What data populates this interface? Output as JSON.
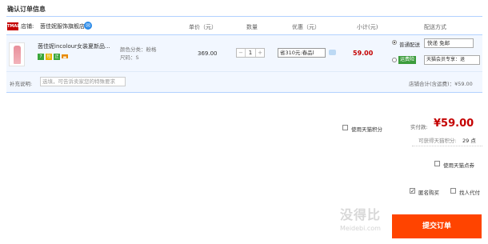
{
  "page": {
    "title": "确认订单信息"
  },
  "columns": {
    "unit_price": "单价（元）",
    "quantity": "数量",
    "discount": "优惠（元）",
    "subtotal": "小计(元)",
    "shipping": "配送方式"
  },
  "store": {
    "badge": "TMALL",
    "label": "店铺:",
    "name": "茵佳妮服饰旗舰店"
  },
  "product": {
    "title": "茵佳妮incolour女装夏新品...",
    "color": "颜色分类：粉格",
    "size": "尺码：S",
    "price": "369.00",
    "quantity": "1",
    "coupon": "省310元:春品l",
    "subtotal": "59.00",
    "tags": [
      "7",
      "包",
      "正",
      "▬"
    ]
  },
  "shipping": {
    "option1_label": "普通配送",
    "option1_select": "快递 免邮",
    "option2_badge": "运费险",
    "option2_select": "天猫会员专享：退"
  },
  "remark": {
    "label": "补充说明:",
    "placeholder": "选填，可告诉卖家您的特殊要求"
  },
  "store_total": "店铺合计(含运费)：¥59.00",
  "options": {
    "tmall_points": "使用天猫积分",
    "tmall_coupon": "使用天猫点券",
    "anonymous": "匿名购买",
    "proxy_pay": "找人代付"
  },
  "summary": {
    "paid_label": "实付款:",
    "paid_amount": "¥59.00",
    "points_label": "可获得天猫积分:",
    "points_value": "29 点"
  },
  "submit": {
    "label": "提交订单"
  },
  "watermark": {
    "main": "没得比",
    "sub": "Meidebi.com"
  }
}
